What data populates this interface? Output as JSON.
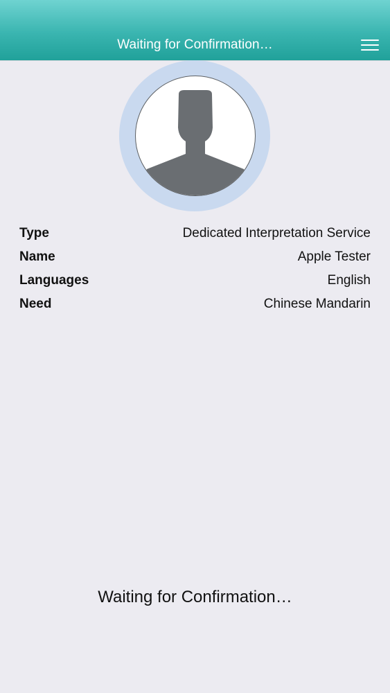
{
  "header": {
    "title": "Waiting for Confirmation…",
    "menu_icon": "hamburger-menu-icon",
    "colors": {
      "gradient_top": "#6fd3d1",
      "gradient_bottom": "#20a19a"
    }
  },
  "avatar": {
    "icon": "person-silhouette-icon",
    "halo_color": "#c9d9ef",
    "silhouette_color": "#6a6e72"
  },
  "details": [
    {
      "label": "Type",
      "value": "Dedicated Interpretation Service"
    },
    {
      "label": "Name",
      "value": "Apple Tester"
    },
    {
      "label": "Languages",
      "value": "English"
    },
    {
      "label": "Need",
      "value": "Chinese Mandarin"
    }
  ],
  "footer": {
    "status": "Waiting for Confirmation…"
  }
}
